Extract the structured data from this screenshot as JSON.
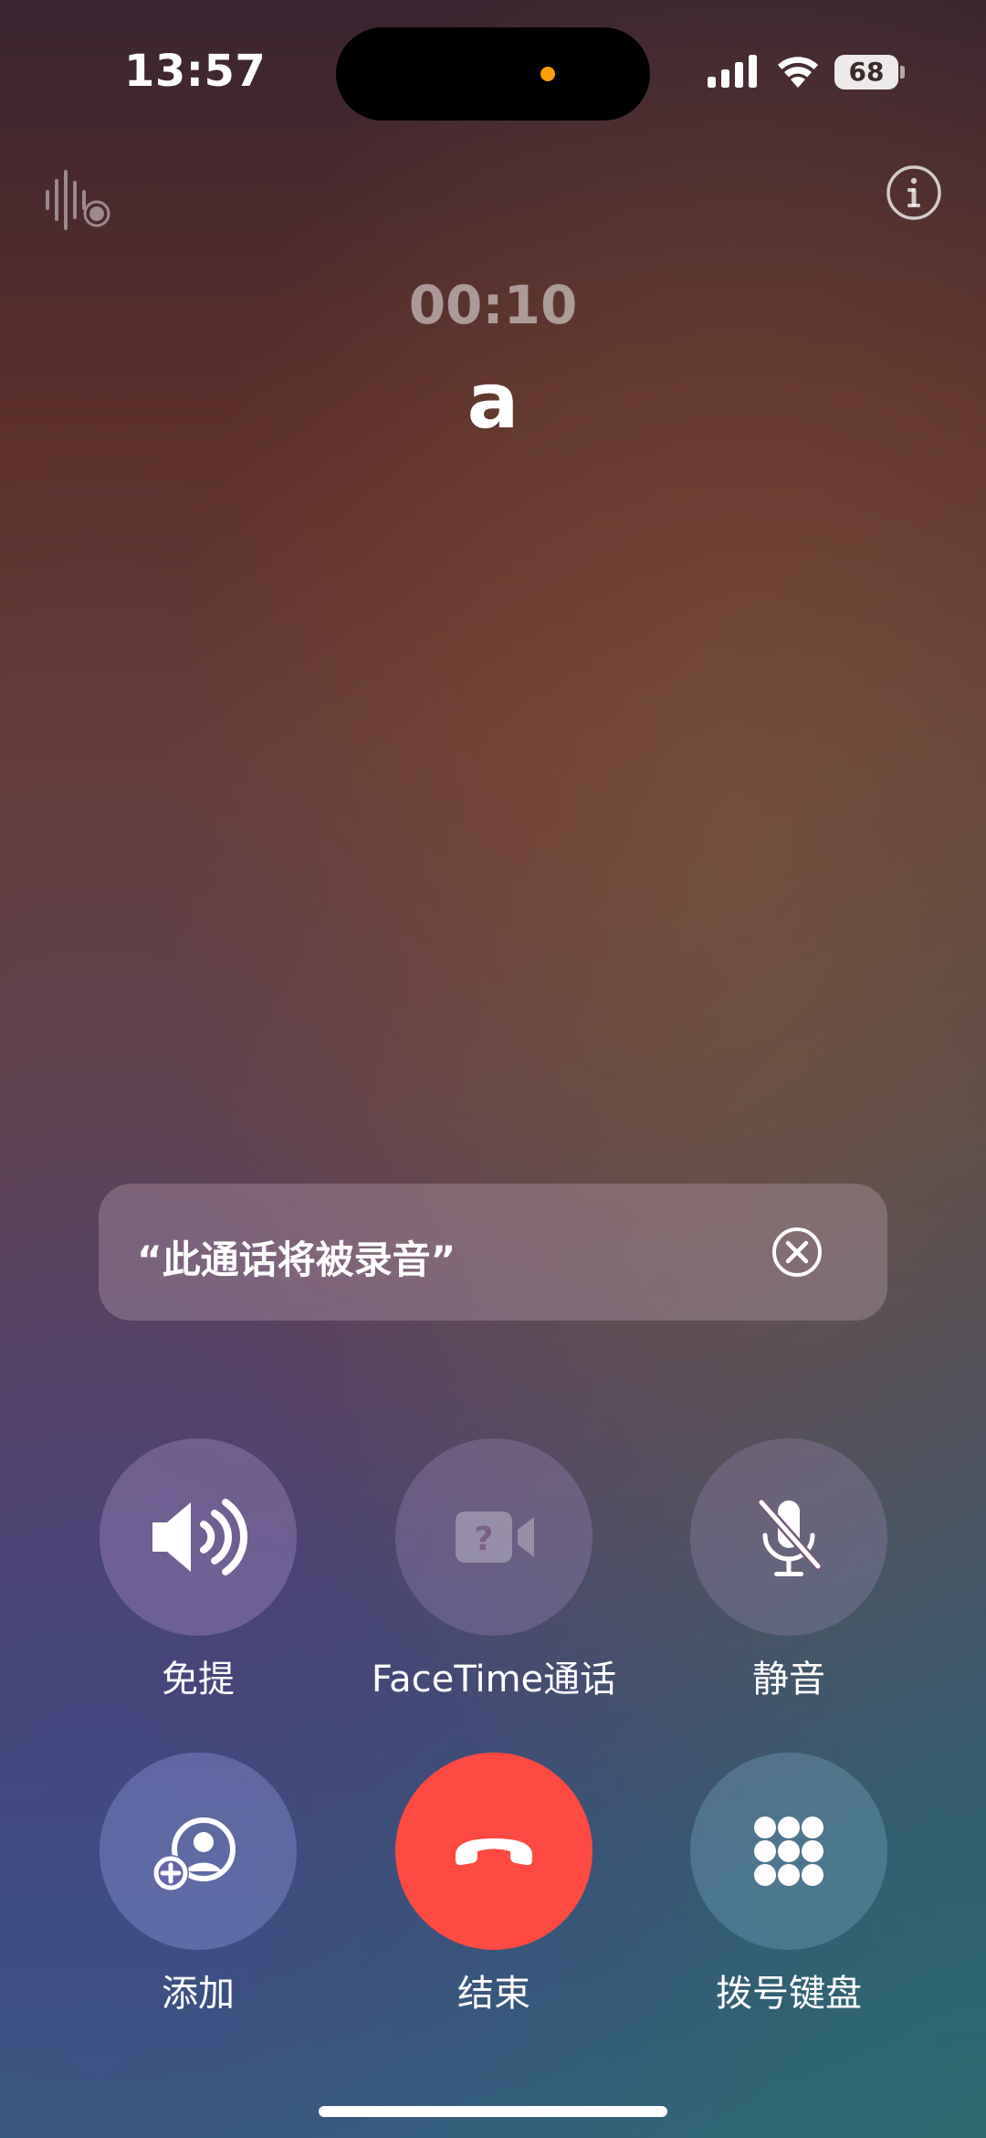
{
  "status_bar": {
    "time": "13:57",
    "battery_level": "68",
    "icons": [
      "cellular-signal-icon",
      "wifi-icon",
      "battery-icon"
    ],
    "privacy_indicator_color": "#ff9f0a"
  },
  "top_icons": {
    "left": "audio-recording-icon",
    "right": "info-icon"
  },
  "call": {
    "duration": "00:10",
    "caller": "a"
  },
  "notice": {
    "text": "“此通话将被录音”",
    "icon": "close-circle-icon"
  },
  "controls": [
    {
      "id": "speaker",
      "label": "免提",
      "icon": "speaker-icon",
      "enabled": true
    },
    {
      "id": "facetime",
      "label": "FaceTime通话",
      "icon": "facetime-unavailable-icon",
      "enabled": false
    },
    {
      "id": "mute",
      "label": "静音",
      "icon": "mic-muted-icon",
      "enabled": false
    },
    {
      "id": "add",
      "label": "添加",
      "icon": "add-call-icon",
      "enabled": true
    },
    {
      "id": "end",
      "label": "结束",
      "icon": "end-call-icon",
      "enabled": true
    },
    {
      "id": "keypad",
      "label": "拨号键盘",
      "icon": "keypad-icon",
      "enabled": true
    }
  ],
  "colors": {
    "end_call": "#fe4a41"
  }
}
